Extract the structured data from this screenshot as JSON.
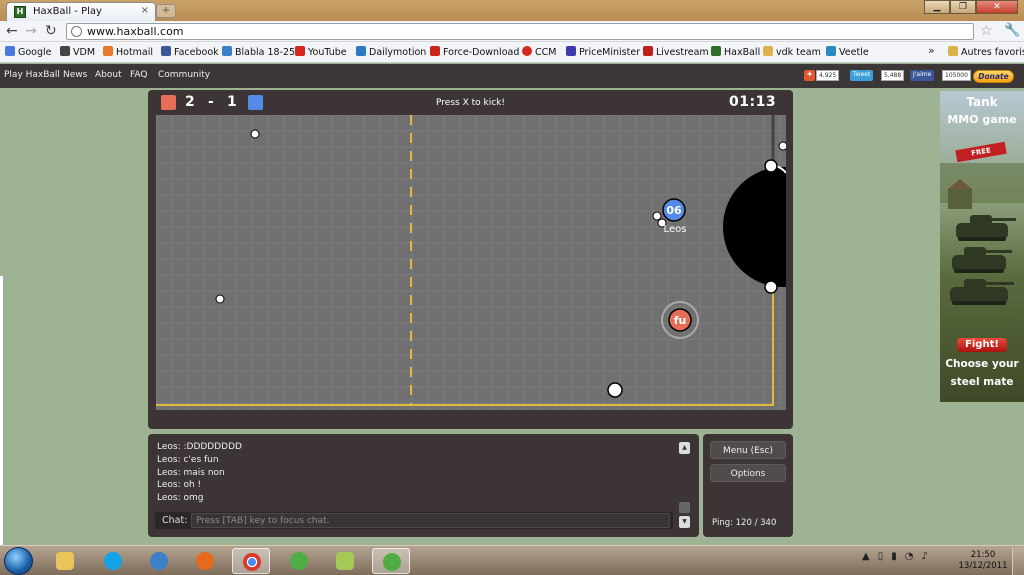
{
  "browser": {
    "tab_title": "HaxBall - Play",
    "tab_favicon_letter": "H",
    "tab_close": "×",
    "newtab_label": "+",
    "url": "www.haxball.com",
    "window_controls": {
      "minimize": "▁",
      "restore": "❐",
      "close": "✕"
    }
  },
  "bookmarks": [
    {
      "label": "Google",
      "color": "#4a7bdc"
    },
    {
      "label": "VDM",
      "color": "#444444"
    },
    {
      "label": "Hotmail",
      "color": "#e8782b"
    },
    {
      "label": "Facebook",
      "color": "#3b5998"
    },
    {
      "label": "Blabla 18-25",
      "color": "#3a7fc8"
    },
    {
      "label": "YouTube",
      "color": "#d8261e"
    },
    {
      "label": "Dailymotion",
      "color": "#2b79c2"
    },
    {
      "label": "Force-Download",
      "color": "#c9261e"
    },
    {
      "label": "CCM",
      "color": "#d8261e"
    },
    {
      "label": "PriceMinister",
      "color": "#3a3aa8"
    },
    {
      "label": "Livestream",
      "color": "#c0201a"
    },
    {
      "label": "HaxBall",
      "color": "#2f6d2a"
    },
    {
      "label": "vdk team",
      "color": "#d9b24a"
    },
    {
      "label": "Veetle",
      "color": "#2a8ac0"
    }
  ],
  "bookmarks_more": "»",
  "bookmarks_other": "Autres favoris",
  "site_nav": [
    "Play HaxBall",
    "News",
    "About",
    "FAQ",
    "Community"
  ],
  "social": {
    "share_count": "4,925",
    "tweet_label": "Tweet",
    "tweet_count": "5,488",
    "like_label": "J'aime",
    "like_count": "105000",
    "donate_label": "Donate"
  },
  "game": {
    "red_score": "2",
    "score_sep": "-",
    "blue_score": "1",
    "kick_hint": "Press X to kick!",
    "timer": "01:13",
    "colors": {
      "red": "#e56e56",
      "blue": "#5689e5",
      "line": "#e3b83e"
    },
    "players": [
      {
        "label": "06",
        "name": "Leos",
        "team": "blue"
      },
      {
        "label": "fu",
        "name": "",
        "team": "red"
      }
    ]
  },
  "chat": {
    "lines": [
      "Leos: :DDDDDDDD",
      "Leos: c'es fun",
      "Leos: mais non",
      "Leos: oh !",
      "Leos: omg"
    ],
    "label": "Chat:",
    "placeholder": "Press [TAB] key to focus chat."
  },
  "menu": {
    "menu_label": "Menu (Esc)",
    "options_label": "Options",
    "ping": "Ping: 120 / 340"
  },
  "ad": {
    "title_line1": "Tank",
    "title_line2": "MMO game",
    "free": "FREE",
    "fight": "Fight!",
    "tagline_line1": "Choose your",
    "tagline_line2": "steel mate"
  },
  "taskbar": {
    "time": "21:50",
    "date": "13/12/2011"
  }
}
